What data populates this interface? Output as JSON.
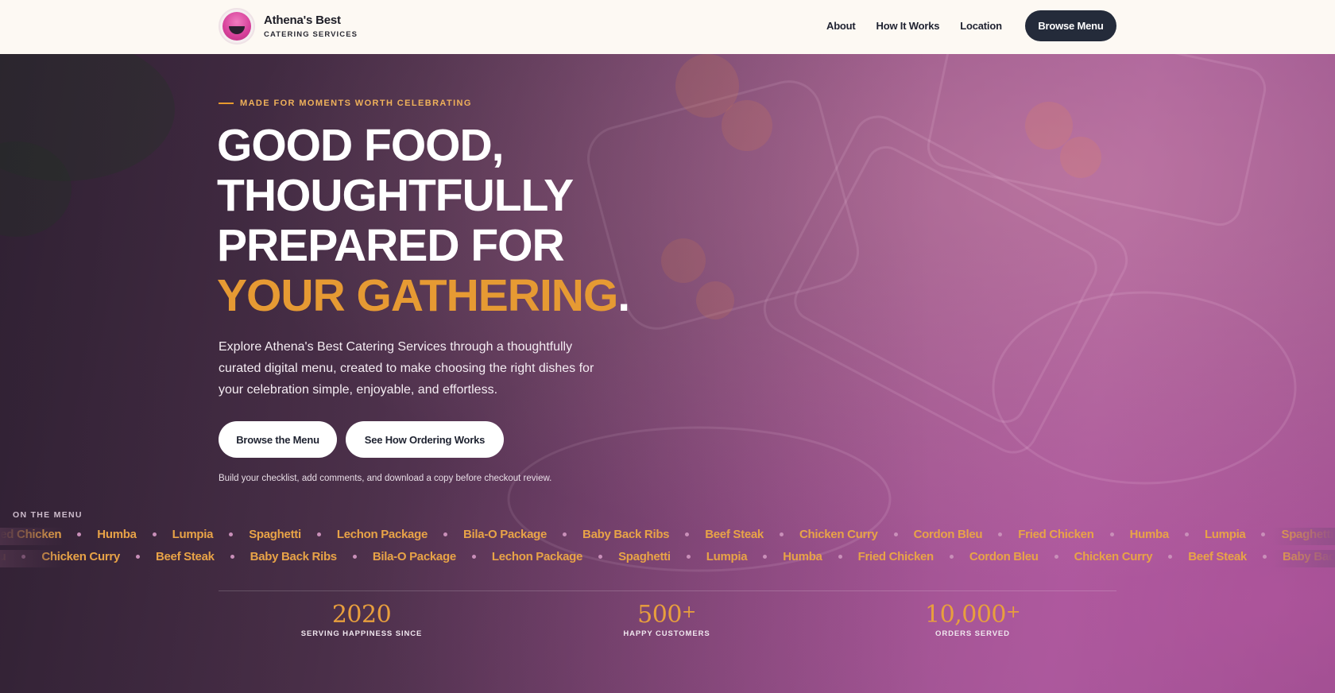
{
  "nav": {
    "brand_name": "Athena's Best",
    "brand_sub": "CATERING SERVICES",
    "links": [
      "About",
      "How It Works",
      "Location"
    ],
    "cta": "Browse Menu"
  },
  "hero": {
    "eyebrow": "MADE FOR MOMENTS WORTH CELEBRATING",
    "headline_lines": [
      "GOOD FOOD,",
      "THOUGHTFULLY",
      "PREPARED FOR"
    ],
    "headline_accent": "YOUR GATHERING",
    "headline_dot": ".",
    "lead": "Explore Athena's Best Catering Services through a thoughtfully curated digital menu, created to make choosing the right dishes for your celebration simple, enjoyable, and effortless.",
    "cta_primary": "Browse the Menu",
    "cta_secondary": "See How Ordering Works",
    "note": "Build your checklist, add comments, and download a copy before checkout review."
  },
  "menu": {
    "label": "ON THE MENU",
    "row1": [
      "Fried Chicken",
      "Humba",
      "Lumpia",
      "Spaghetti",
      "Lechon Package",
      "Bila-O Package",
      "Baby Back Ribs",
      "Beef Steak",
      "Chicken Curry",
      "Cordon Bleu",
      "Fried Chicken",
      "Humba",
      "Lumpia",
      "Spaghetti"
    ],
    "row2": [
      "Bleu",
      "Chicken Curry",
      "Beef Steak",
      "Baby Back Ribs",
      "Bila-O Package",
      "Lechon Package",
      "Spaghetti",
      "Lumpia",
      "Humba",
      "Fried Chicken",
      "Cordon Bleu",
      "Chicken Curry",
      "Beef Steak",
      "Baby Back Ribs"
    ]
  },
  "stats": [
    {
      "number": "2020",
      "plus": "",
      "label": "SERVING HAPPINESS SINCE"
    },
    {
      "number": "500",
      "plus": "+",
      "label": "HAPPY CUSTOMERS"
    },
    {
      "number": "10,000",
      "plus": "+",
      "label": "ORDERS SERVED"
    }
  ],
  "colors": {
    "accent": "#e69a33",
    "nav_bg": "#fdf9f3",
    "dark_button": "#242b3a"
  }
}
